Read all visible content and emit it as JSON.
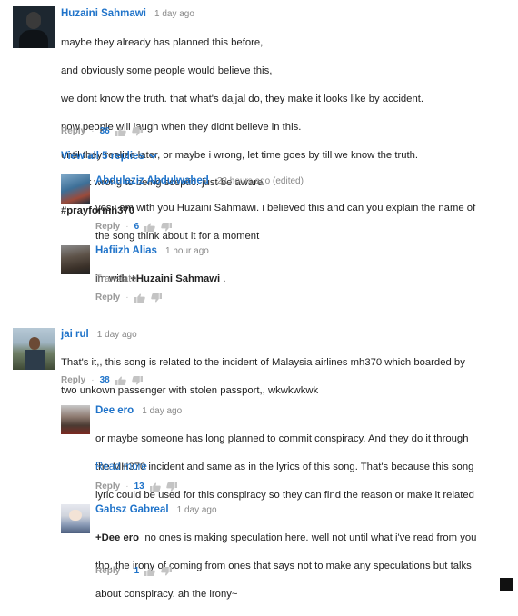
{
  "comments": {
    "c1": {
      "author": "Huzaini Sahmawi",
      "time": "1 day ago",
      "lines": [
        "maybe they already has planned this before,",
        "and obviously some people would believe this,",
        "we dont know the truth. that what's dajjal do, they make it looks like by accident.",
        "now people will laugh when they didnt believe in this.",
        "until they realize later, or maybe i wrong, let time goes by till we know the truth.",
        " its not wrong to being sceptic. just be aware"
      ],
      "hashtag": "#prayformh370",
      "reply": "Reply",
      "likes": "36"
    },
    "view_all": "View all 5 replies",
    "r1": {
      "author": "Abdulaziz Abdulwahed",
      "time": "22 hours ago (edited)",
      "line1": "yes i am with you Huzaini Sahmawi. i believed this and can you explain the name of",
      "line2": "the song think about it for a moment",
      "reply": "Reply",
      "likes": "6"
    },
    "r2": {
      "author": "Hafiizh Alias",
      "time": "1 hour ago",
      "prefix": "im with ",
      "mention": "+Huzaini Sahmawi",
      "suffix": " .",
      "translate": "Translate",
      "reply": "Reply"
    },
    "c2": {
      "author": "jai rul",
      "time": "1 day ago",
      "line1": "That's it,, this song is related to the incident of Malaysia airlines mh370 which boarded by",
      "line2": "two unkown passenger with stolen passport,, wkwkwkwk",
      "reply": "Reply",
      "likes": "38"
    },
    "r3": {
      "author": "Dee ero",
      "time": "1 day ago",
      "line1": "or maybe someone has long planned to commit conspiracy. And they do it through",
      "line2": "the MH370 incident and same as in the lyrics of this song. That's because this song",
      "line3": "lyric could be used for this conspiracy so they can find the reason or make it related",
      "read_more": "Read more",
      "reply": "Reply",
      "likes": "13"
    },
    "r4": {
      "author": "Gabsz Gabreal",
      "time": "1 day ago",
      "mention": "+Dee ero",
      "line1_rest": "  no ones is making speculation here. well not until what i've read from you",
      "line2": "tho. the irony of coming from ones that says not to make any speculations but talks",
      "line3": "about conspiracy. ah the irony~",
      "reply": "Reply",
      "likes": "1"
    }
  },
  "icons": {
    "thumb_up": "thumb-up-icon",
    "thumb_down": "thumb-down-icon",
    "chevron": "chevron-down-icon"
  },
  "colors": {
    "author": "#1f73c9",
    "meta": "#888888",
    "text": "#222222"
  }
}
